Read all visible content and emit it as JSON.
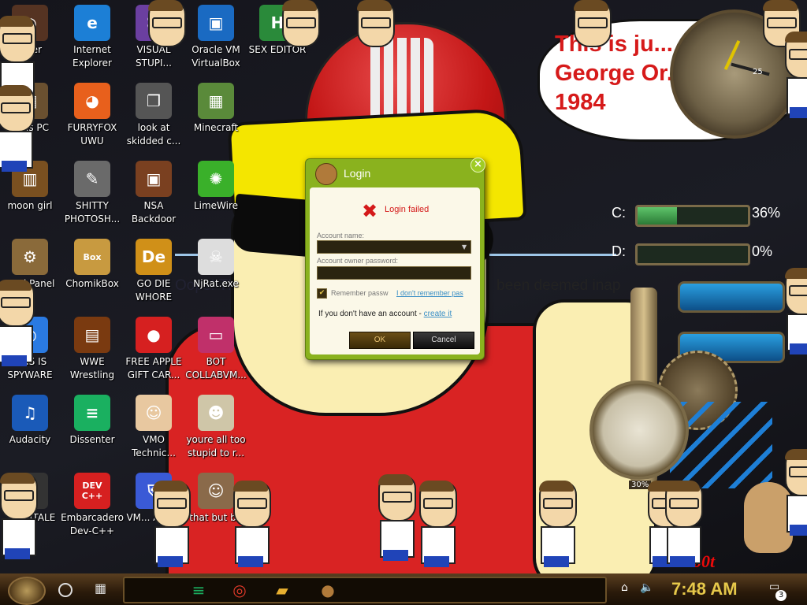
{
  "wallpaper": {
    "bubble_text": "This is ju... George Or... 1984",
    "banner_left": "Oops! That has",
    "banner_right": "been deemed inap",
    "tag": "0b0t"
  },
  "sysmon": {
    "drives": [
      {
        "label": "C:",
        "percent": "36%",
        "fill": 0.36
      },
      {
        "label": "D:",
        "percent": "0%",
        "fill": 0.0
      }
    ],
    "gauge_percent": "30%",
    "clock_number": "25"
  },
  "desktop_icons": [
    {
      "label": "...ser",
      "icon": "browser-icon",
      "color": "#553322",
      "glyph": "◉"
    },
    {
      "label": "Internet Explorer",
      "icon": "edge-icon",
      "color": "#1c7fd6",
      "glyph": "e"
    },
    {
      "label": "VISUAL STUPI...",
      "icon": "visual-studio-icon",
      "color": "#6b3fa0",
      "glyph": "⌘"
    },
    {
      "label": "Oracle VM VirtualBox",
      "icon": "virtualbox-icon",
      "color": "#1a6ac2",
      "glyph": "▣"
    },
    {
      "label": "SEX EDITOR",
      "icon": "hex-editor-icon",
      "color": "#2a8a3a",
      "glyph": "H"
    },
    {
      "label": "...his PC",
      "icon": "this-pc-icon",
      "color": "#6a5030",
      "glyph": "▤"
    },
    {
      "label": "FURRYFOX UWU",
      "icon": "firefox-icon",
      "color": "#e8601c",
      "glyph": "◕"
    },
    {
      "label": "look at skidded c...",
      "icon": "files-icon",
      "color": "#555",
      "glyph": "❐"
    },
    {
      "label": "Minecraft",
      "icon": "minecraft-icon",
      "color": "#5a8a3a",
      "glyph": "▦"
    },
    {
      "label": "moon girl",
      "icon": "lantern-icon",
      "color": "#7a5020",
      "glyph": "▥"
    },
    {
      "label": "SHITTY PHOTOSH...",
      "icon": "gimp-icon",
      "color": "#6a6a6a",
      "glyph": "✎"
    },
    {
      "label": "NSA Backdoor",
      "icon": "nsa-icon",
      "color": "#7a4020",
      "glyph": "▣"
    },
    {
      "label": "LimeWire",
      "icon": "limewire-icon",
      "color": "#3ab02a",
      "glyph": "✺"
    },
    {
      "label": "...rol Panel",
      "icon": "control-panel-icon",
      "color": "#8a6a3a",
      "glyph": "⚙"
    },
    {
      "label": "ChomikBox",
      "icon": "chomikbox-icon",
      "color": "#c89a40",
      "glyph": "Box"
    },
    {
      "label": "GO DIE WHORE",
      "icon": "de-icon",
      "color": "#d09018",
      "glyph": "De"
    },
    {
      "label": "NjRat.exe",
      "icon": "skull-icon",
      "color": "#ddd",
      "glyph": "☠"
    },
    {
      "label": "THIS IS SPYWARE",
      "icon": "chrome-icon",
      "color": "#2a7ae2",
      "glyph": "◎"
    },
    {
      "label": "WWE Wrestling",
      "icon": "wwe-icon",
      "color": "#7a3a10",
      "glyph": "▤"
    },
    {
      "label": "FREE APPLE GIFT CAR...",
      "icon": "apple-icon",
      "color": "#d62020",
      "glyph": "●"
    },
    {
      "label": "BOT COLLABVM...",
      "icon": "monitor-icon",
      "color": "#c0306a",
      "glyph": "▭"
    },
    {
      "label": "Audacity",
      "icon": "audacity-icon",
      "color": "#1a5ab8",
      "glyph": "♫"
    },
    {
      "label": "Dissenter",
      "icon": "dissenter-icon",
      "color": "#1ab060",
      "glyph": "≡"
    },
    {
      "label": "VMO Technic...",
      "icon": "doctor-icon",
      "color": "#e8c8a0",
      "glyph": "☺"
    },
    {
      "label": "youre all too stupid to r...",
      "icon": "portrait-icon",
      "color": "#cfc6a8",
      "glyph": "☻"
    },
    {
      "label": "...DERTALE",
      "icon": "unity-icon",
      "color": "#333",
      "glyph": "◆"
    },
    {
      "label": "Embarcadero Dev-C++",
      "icon": "devcpp-icon",
      "color": "#d62020",
      "glyph": "DEV C++"
    },
    {
      "label": "VM... Anti...",
      "icon": "shield-icon",
      "color": "#3a5ad6",
      "glyph": "⛨"
    },
    {
      "label": "that but bit",
      "icon": "painting-icon",
      "color": "#8a6a4a",
      "glyph": "☺"
    }
  ],
  "login": {
    "title": "Login",
    "close": "×",
    "status": "Login failed",
    "account_label": "Account name:",
    "account_value": "",
    "password_label": "Account owner password:",
    "password_value": "",
    "remember_label": "Remember passw",
    "remember_checked": "✔",
    "forgot_link": "I don't remember pas",
    "signup_prefix": "If you don't have an account - ",
    "signup_link": "create it",
    "ok_button": "OK",
    "cancel_button": "Cancel"
  },
  "taskbar": {
    "clock": "7:48 AM",
    "notification_count": "3",
    "apps": [
      {
        "icon": "dissenter-icon",
        "glyph": "≡",
        "color": "#1ab060"
      },
      {
        "icon": "chrome-icon",
        "glyph": "◎",
        "color": "#e23a2a"
      },
      {
        "icon": "folder-icon",
        "glyph": "▰",
        "color": "#e8b030"
      },
      {
        "icon": "chomikbox-icon",
        "glyph": "●",
        "color": "#b07a3a"
      }
    ]
  }
}
